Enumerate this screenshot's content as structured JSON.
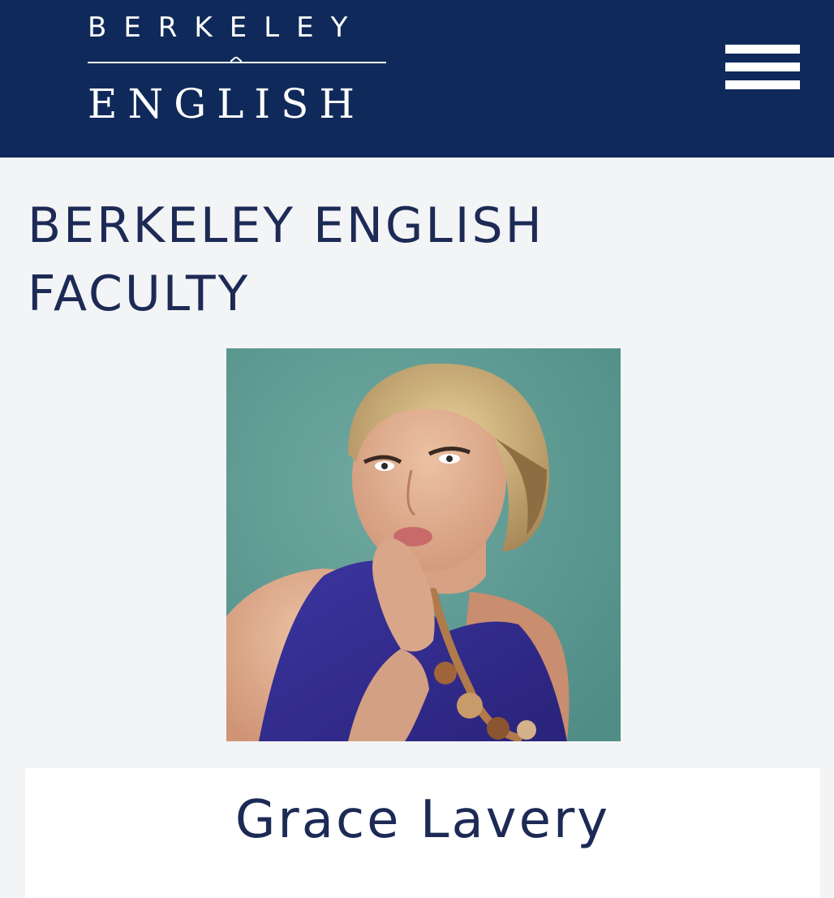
{
  "header": {
    "logo_top": "BERKELEY",
    "logo_bottom": "ENGLISH",
    "background_color": "#0f2a5a",
    "menu_icon": "hamburger-menu-icon"
  },
  "main": {
    "page_title": "BERKELEY ENGLISH FACULTY",
    "title_color": "#1c2a55"
  },
  "profile": {
    "name": "Grace Lavery"
  }
}
